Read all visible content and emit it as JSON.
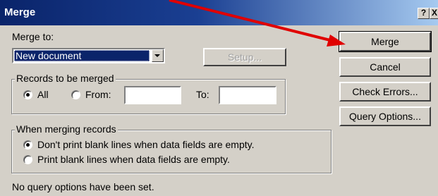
{
  "window": {
    "title": "Merge",
    "help_button_label": "?",
    "close_button_label": "X"
  },
  "merge_to": {
    "label": "Merge to:",
    "selected_value": "New document"
  },
  "buttons": {
    "setup": "Setup...",
    "merge": "Merge",
    "cancel": "Cancel",
    "check_errors": "Check Errors...",
    "query_options": "Query Options..."
  },
  "records_group": {
    "title": "Records to be merged",
    "all_label": "All",
    "from_label": "From:",
    "to_label": "To:",
    "from_value": "",
    "to_value": ""
  },
  "merging_group": {
    "title": "When merging records",
    "option_dont_print": "Don't print blank lines when data fields are empty.",
    "option_print": "Print blank lines when data fields are empty."
  },
  "status_text": "No query options have been set.",
  "colors": {
    "title_gradient_start": "#0a246a",
    "title_gradient_end": "#a6caf0",
    "annotation_arrow": "#e00000",
    "dialog_background": "#d4d0c8"
  },
  "annotation": {
    "type": "red-arrow",
    "points_to": "merge-button"
  }
}
